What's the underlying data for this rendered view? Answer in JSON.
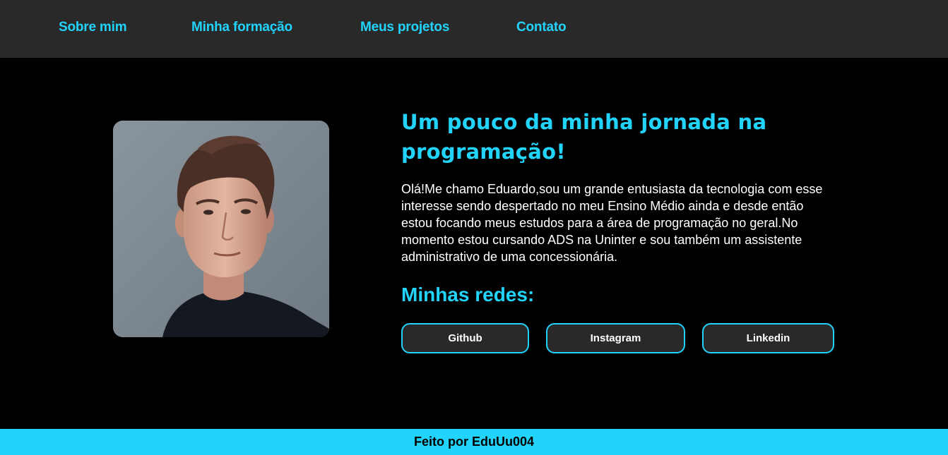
{
  "nav": {
    "items": [
      {
        "label": "Sobre mim"
      },
      {
        "label": "Minha formação"
      },
      {
        "label": "Meus projetos"
      },
      {
        "label": "Contato"
      }
    ]
  },
  "about": {
    "title": "Um pouco da minha jornada na programação!",
    "bio": "Olá!Me chamo Eduardo,sou um grande entusiasta da tecnologia com esse interesse sendo despertado no meu Ensino Médio ainda e desde então estou focando meus estudos para a área de programação no geral.No momento estou cursando ADS na Uninter e sou também um assistente administrativo de uma concessionária.",
    "social_title": "Minhas redes:",
    "social": [
      {
        "label": "Github"
      },
      {
        "label": "Instagram"
      },
      {
        "label": "Linkedin"
      }
    ]
  },
  "footer": {
    "text": "Feito por EduUu004"
  },
  "colors": {
    "accent": "#22d3fb",
    "nav_bg": "#292929",
    "page_bg": "#000000"
  }
}
